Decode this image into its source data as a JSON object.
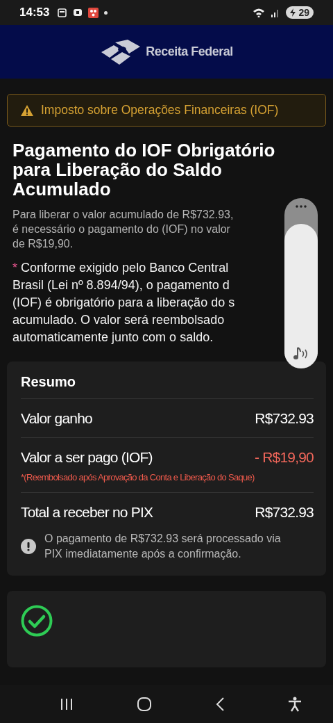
{
  "status_bar": {
    "time": "14:53",
    "battery": "29"
  },
  "header": {
    "logo_text": "Receita Federal"
  },
  "alert": {
    "text": "Imposto sobre Operações Financeiras (IOF)"
  },
  "title": "Pagamento do IOF Obrigatório para Liberação do Saldo Acumulado",
  "intro_lines": [
    "Para liberar o valor acumulado de R$732.93,",
    "é necessário o pagamento do (IOF) no valor",
    "de R$19,90."
  ],
  "note": {
    "mark": "*",
    "lines": [
      "Conforme exigido pelo Banco Central",
      "Brasil (Lei nº 8.894/94), o pagamento d",
      "(IOF) é obrigatório para a liberação do s",
      "acumulado. O valor será reembolsado",
      "automaticamente junto com o saldo."
    ]
  },
  "summary": {
    "title": "Resumo",
    "rows": [
      {
        "label": "Valor ganho",
        "value": "R$732.93",
        "kind": "plain"
      },
      {
        "label": "Valor a ser pago (IOF)",
        "value": "- R$19,90",
        "kind": "deduction",
        "footnote": "*(Reembolsado após Aprovação da Conta e Liberação do Saque)"
      },
      {
        "label": "Total a receber no PIX",
        "value": "R$732.93",
        "kind": "plain"
      }
    ],
    "info": "O pagamento de R$732.93 será processado via PIX imediatamente após a confirmação."
  },
  "volume_panel": {
    "level": 0.85
  }
}
